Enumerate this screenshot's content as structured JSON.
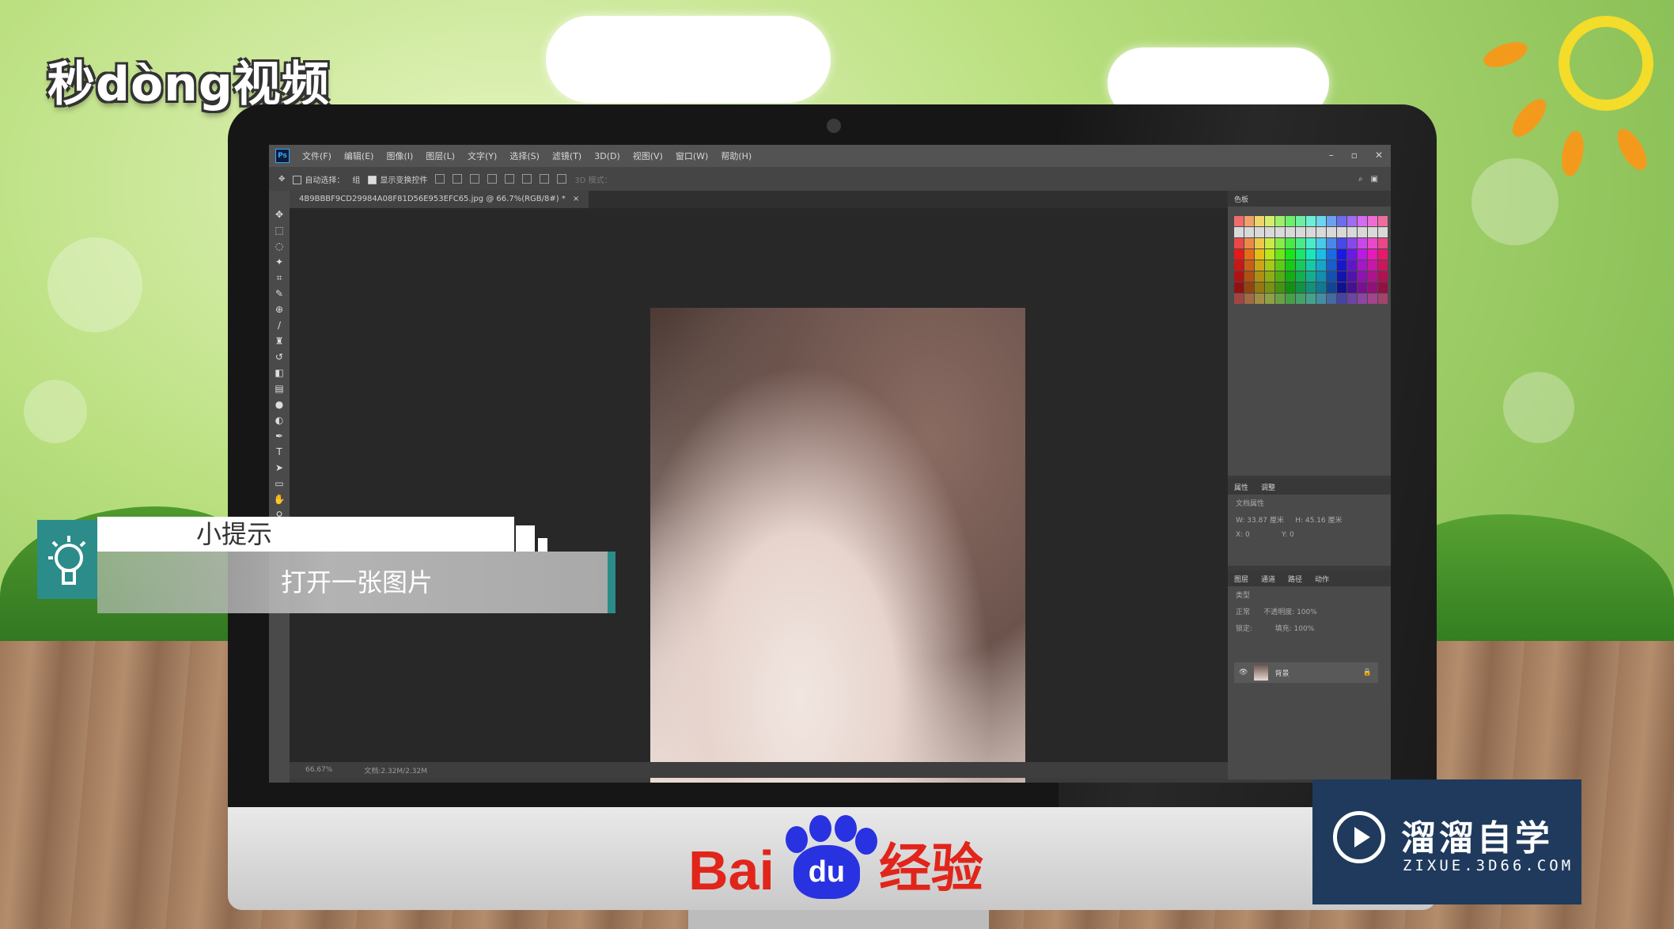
{
  "brand": {
    "text": "秒dòng视频"
  },
  "photoshop": {
    "menu": [
      "文件(F)",
      "编辑(E)",
      "图像(I)",
      "图层(L)",
      "文字(Y)",
      "选择(S)",
      "滤镜(T)",
      "3D(D)",
      "视图(V)",
      "窗口(W)",
      "帮助(H)"
    ],
    "options": {
      "auto_select": "自动选择：",
      "layer": "组",
      "show_transform": "显示变换控件",
      "mode_3d": "3D 模式："
    },
    "doc_tab": "4B9BBBF9CD29984A08F81D56E953EFC65.jpg @ 66.7%(RGB/8#) *",
    "status": {
      "zoom": "66.67%",
      "doc": "文档:2.32M/2.32M"
    },
    "panels": {
      "swatches_tab": "色板",
      "properties_tabs": [
        "属性",
        "调整"
      ],
      "doc_props": "文档属性",
      "w": "W: 33.87 厘米",
      "h": "H: 45.16 厘米",
      "x": "X: 0",
      "y": "Y: 0",
      "layers_tabs": [
        "图层",
        "通道",
        "路径",
        "动作"
      ],
      "kind": "类型",
      "blend": "正常",
      "opacity": "不透明度: 100%",
      "lock": "锁定:",
      "fill": "填充: 100%",
      "layer_name": "背景"
    }
  },
  "tip": {
    "title": "小提示",
    "text": "打开一张图片"
  },
  "baidu": {
    "left": "Bai",
    "paw": "du",
    "right": "经验"
  },
  "zixue": {
    "title": "溜溜自学",
    "url": "ZIXUE.3D66.COM"
  }
}
